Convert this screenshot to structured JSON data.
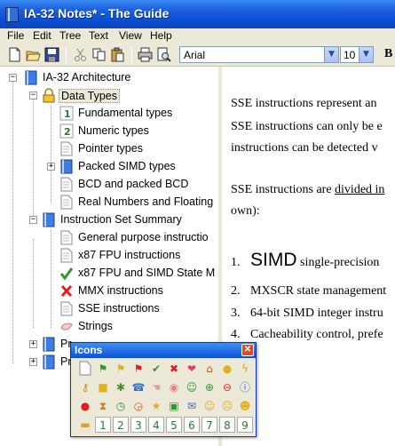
{
  "window": {
    "title": "IA-32 Notes* - The Guide"
  },
  "menu": [
    "File",
    "Edit",
    "Tree",
    "Text",
    "View",
    "Help"
  ],
  "toolbar": {
    "font": "Arial",
    "size": "10",
    "bold_label": "B",
    "buttons": [
      "new-icon",
      "open-icon",
      "save-icon",
      "cut-icon",
      "copy-icon",
      "paste-icon",
      "print-icon",
      "print-preview-icon"
    ]
  },
  "tree": {
    "nodes": [
      {
        "label": "IA-32 Architecture",
        "icon": "book-icon"
      },
      {
        "label": "Data Types",
        "icon": "lock-icon"
      },
      {
        "label": "Fundamental types",
        "icon": "number-1-icon"
      },
      {
        "label": "Numeric types",
        "icon": "number-2-icon"
      },
      {
        "label": "Pointer types",
        "icon": "page-icon"
      },
      {
        "label": "Packed SIMD types",
        "icon": "book-icon"
      },
      {
        "label": "BCD and packed BCD",
        "icon": "page-icon"
      },
      {
        "label": "Real Numbers and Floating",
        "icon": "page-icon"
      },
      {
        "label": "Instruction Set Summary",
        "icon": "book-icon"
      },
      {
        "label": "General purpose instructio",
        "icon": "page-icon"
      },
      {
        "label": "x87 FPU instructions",
        "icon": "page-icon"
      },
      {
        "label": "x87 FPU and SIMD State M",
        "icon": "check-icon"
      },
      {
        "label": "MMX instructions",
        "icon": "cross-icon"
      },
      {
        "label": "SSE instructions",
        "icon": "page-icon"
      },
      {
        "label": "Strings",
        "icon": "hand-icon"
      },
      {
        "label": "Pr",
        "icon": "book-icon"
      },
      {
        "label": "Pr",
        "icon": "book-icon"
      }
    ]
  },
  "editor": {
    "lines": [
      "SSE instructions represent an",
      "SSE instructions can only be e",
      "instructions can be detected v",
      "SSE instructions are ",
      "own):"
    ],
    "underlined": "divided in",
    "list": [
      {
        "num": "1.",
        "big": "SIMD",
        "rest": " single-precision"
      },
      {
        "num": "2.",
        "text": "MXSCR state management"
      },
      {
        "num": "3.",
        "text": "64-bit SIMD integer instru"
      },
      {
        "num": "4.",
        "text": "Cacheability control, prefe"
      }
    ]
  },
  "palette": {
    "title": "Icons",
    "icons": [
      [
        "page-icon",
        "green-flag-icon",
        "yellow-flag-icon",
        "red-flag-icon",
        "check-icon",
        "cross-icon",
        "heart-icon",
        "house-icon",
        "bulb-icon",
        "lightning-icon"
      ],
      [
        "key-icon",
        "lock-icon",
        "bug-icon",
        "phone-icon",
        "hand-icon",
        "speech-bubble-icon",
        "smiley-icon",
        "plus-icon",
        "minus-icon",
        "info-icon"
      ],
      [
        "warning-icon",
        "hourglass-icon",
        "clock-icon",
        "alarm-icon",
        "star-icon",
        "chat-icon",
        "mail-icon",
        "happy-face-icon",
        "sad-face-icon",
        "neutral-face-icon"
      ],
      [
        "folder-icon",
        "number-1-icon",
        "number-2-icon",
        "number-3-icon",
        "number-4-icon",
        "number-5-icon",
        "number-6-icon",
        "number-7-icon",
        "number-8-icon",
        "number-9-icon"
      ]
    ],
    "numbers": [
      "1",
      "2",
      "3",
      "4",
      "5",
      "6",
      "7",
      "8",
      "9"
    ]
  }
}
